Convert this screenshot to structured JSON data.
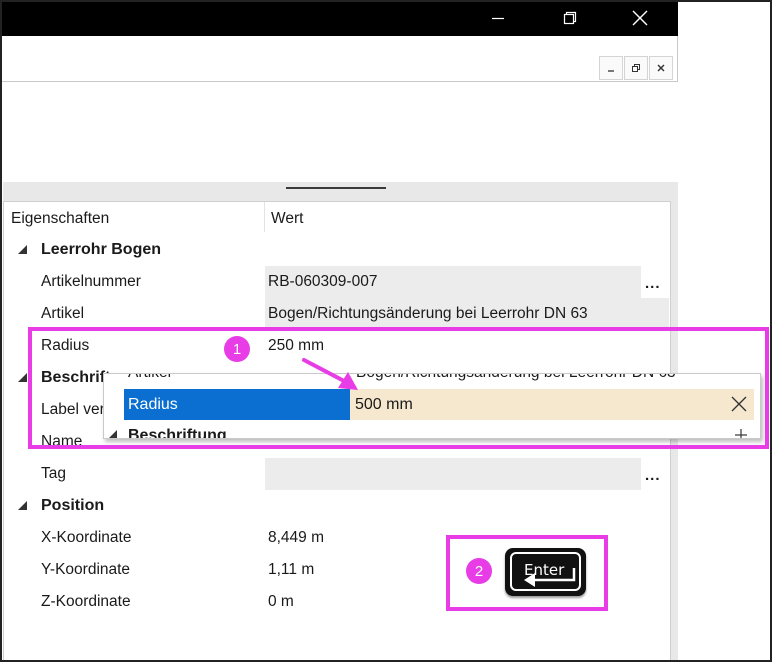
{
  "window": {
    "minimize_icon": "minimize-icon",
    "restore_icon": "restore-icon",
    "close_icon": "close-icon"
  },
  "properties": {
    "header": {
      "col1": "Eigenschaften",
      "col2": "Wert"
    },
    "groups": [
      {
        "name": "Leerrohr Bogen",
        "rows": [
          {
            "label": "Artikelnummer",
            "value": "RB-060309-007",
            "has_ellipsis": true
          },
          {
            "label": "Artikel",
            "value": "Bogen/Richtungsänderung bei Leerrohr DN  63"
          },
          {
            "label": "Radius",
            "value": "250 mm"
          }
        ]
      },
      {
        "name": "Beschrift",
        "rows": [
          {
            "label": "Label ver",
            "value": ""
          },
          {
            "label": "Name",
            "value": ""
          },
          {
            "label": "Tag",
            "value": "",
            "has_ellipsis": true
          }
        ]
      },
      {
        "name": "Position",
        "rows": [
          {
            "label": "X-Koordinate",
            "value": "8,449 m"
          },
          {
            "label": "Y-Koordinate",
            "value": "1,11 m"
          },
          {
            "label": "Z-Koordinate",
            "value": "0 m"
          }
        ]
      }
    ],
    "ellipsis": "..."
  },
  "popup": {
    "ghost_artikel_label": "Artikel",
    "ghost_artikel_value": "Bogen/Richtungsänderung bei Leerrohr DN  63",
    "radius_label": "Radius",
    "radius_value": "500 mm",
    "ghost_group": "Beschriftung",
    "clear_icon": "close-icon",
    "expand_icon": "plus-icon"
  },
  "annotations": {
    "step1": "1",
    "step2": "2",
    "enter_key_label": "Enter",
    "highlight_color": "#e73ce6"
  }
}
